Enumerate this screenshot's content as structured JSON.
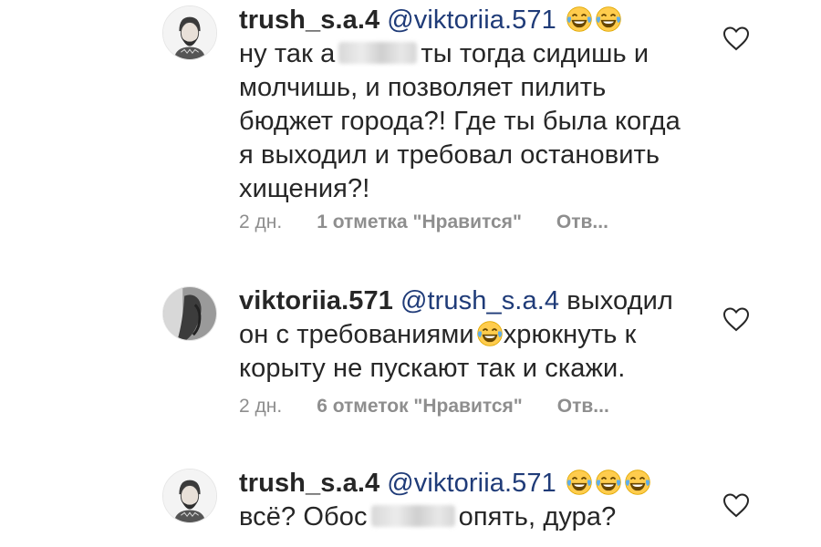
{
  "comments": [
    {
      "username": "trush_s.a.4",
      "mention": "@viktoriia.571",
      "emojis": [
        "joy-icon",
        "joy-icon"
      ],
      "line1_a": "ну так а",
      "line1_b": "ты тогда сидишь",
      "rest": "и молчишь, и позволяет пилить бюджет города?! Где ты была когда я выходил и требовал остановить хищения?!",
      "time": "2 дн.",
      "likes": "1 отметка \"Нравится\"",
      "reply": "Отв..."
    },
    {
      "username": "viktoriia.571",
      "mention": "@trush_s.a.4",
      "text_a": "выходил он с требованиями",
      "emojis": [
        "joy-icon"
      ],
      "text_b": "хрюкнуть к корыту не пускают так и скажи.",
      "time": "2 дн.",
      "likes": "6 отметок \"Нравится\"",
      "reply": "Отв..."
    },
    {
      "username": "trush_s.a.4",
      "mention": "@viktoriia.571",
      "emojis": [
        "joy-icon",
        "joy-icon",
        "joy-icon"
      ],
      "text_a": "всё? Обос",
      "text_b": "опять, дура?"
    }
  ]
}
